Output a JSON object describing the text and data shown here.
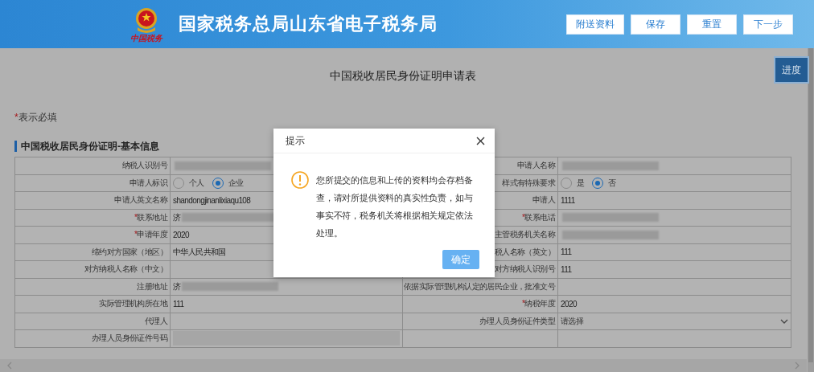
{
  "header": {
    "emblem_caption": "中国税务",
    "title": "国家税务总局山东省电子税务局",
    "buttons": [
      "附送资料",
      "保存",
      "重置",
      "下一步"
    ]
  },
  "page": {
    "title": "中国税收居民身份证明申请表",
    "progress_button": "进度",
    "required_note": {
      "mark": "*",
      "text": "表示必填"
    },
    "section_title": "中国税收居民身份证明-基本信息"
  },
  "table": {
    "rows": [
      {
        "cells": [
          {
            "kind": "label",
            "text": "纳税人识别号"
          },
          {
            "kind": "redacted"
          },
          {
            "kind": "label",
            "text": "申请人名称"
          },
          {
            "kind": "redacted"
          }
        ]
      },
      {
        "cells": [
          {
            "kind": "label",
            "text": "申请人标识"
          },
          {
            "kind": "radio",
            "options": [
              {
                "label": "个人",
                "selected": false
              },
              {
                "label": "企业",
                "selected": true
              }
            ]
          },
          {
            "kind": "label",
            "text": "样式有特殊要求"
          },
          {
            "kind": "radio",
            "options": [
              {
                "label": "是",
                "selected": false
              },
              {
                "label": "否",
                "selected": true
              }
            ]
          }
        ]
      },
      {
        "cells": [
          {
            "kind": "label",
            "text": "申请人英文名称"
          },
          {
            "kind": "text",
            "text": "shandongjinanlixiaqu108"
          },
          {
            "kind": "label",
            "text": "申请人"
          },
          {
            "kind": "text",
            "text": "1111"
          }
        ]
      },
      {
        "cells": [
          {
            "kind": "label",
            "mark": "*",
            "text": "联系地址"
          },
          {
            "kind": "redacted",
            "prefix": "济"
          },
          {
            "kind": "label",
            "mark": "*",
            "text": "联系电话"
          },
          {
            "kind": "redacted"
          }
        ]
      },
      {
        "cells": [
          {
            "kind": "label",
            "mark": "*",
            "text": "申请年度"
          },
          {
            "kind": "text",
            "text": "2020"
          },
          {
            "kind": "label",
            "text": "主管税务机关名称"
          },
          {
            "kind": "redacted"
          }
        ]
      },
      {
        "cells": [
          {
            "kind": "label",
            "text": "缔约对方国家（地区）"
          },
          {
            "kind": "text",
            "text": "中华人民共和国"
          },
          {
            "kind": "label",
            "text": "税人名称（英文）"
          },
          {
            "kind": "text",
            "text": "111"
          }
        ]
      },
      {
        "cells": [
          {
            "kind": "label",
            "text": "对方纳税人名称（中文）"
          },
          {
            "kind": "empty"
          },
          {
            "kind": "label",
            "text": "对方纳税人识别号"
          },
          {
            "kind": "text",
            "text": "111"
          }
        ]
      },
      {
        "cells": [
          {
            "kind": "label",
            "text": "注册地址"
          },
          {
            "kind": "redacted",
            "prefix": "济"
          },
          {
            "kind": "label",
            "text": "依据实际管理机构认定的居民企业，批准文号"
          },
          {
            "kind": "empty"
          }
        ]
      },
      {
        "cells": [
          {
            "kind": "label",
            "text": "实际管理机构所在地"
          },
          {
            "kind": "text",
            "text": "111"
          },
          {
            "kind": "label",
            "mark": "*",
            "text": "纳税年度"
          },
          {
            "kind": "text",
            "text": "2020"
          }
        ]
      },
      {
        "cells": [
          {
            "kind": "label",
            "text": "代理人"
          },
          {
            "kind": "empty"
          },
          {
            "kind": "label",
            "text": "办理人员身份证件类型"
          },
          {
            "kind": "select",
            "text": "请选择"
          }
        ]
      },
      {
        "cells": [
          {
            "kind": "label",
            "text": "办理人员身份证件号码"
          },
          {
            "kind": "disabled"
          },
          {
            "kind": "empty"
          },
          {
            "kind": "empty"
          }
        ]
      }
    ]
  },
  "dialog": {
    "title": "提示",
    "message": "您所提交的信息和上传的资料均会存档备查，请对所提供资料的真实性负责，如与事实不符，税务机关将根据相关规定依法处理。",
    "confirm": "确定"
  }
}
